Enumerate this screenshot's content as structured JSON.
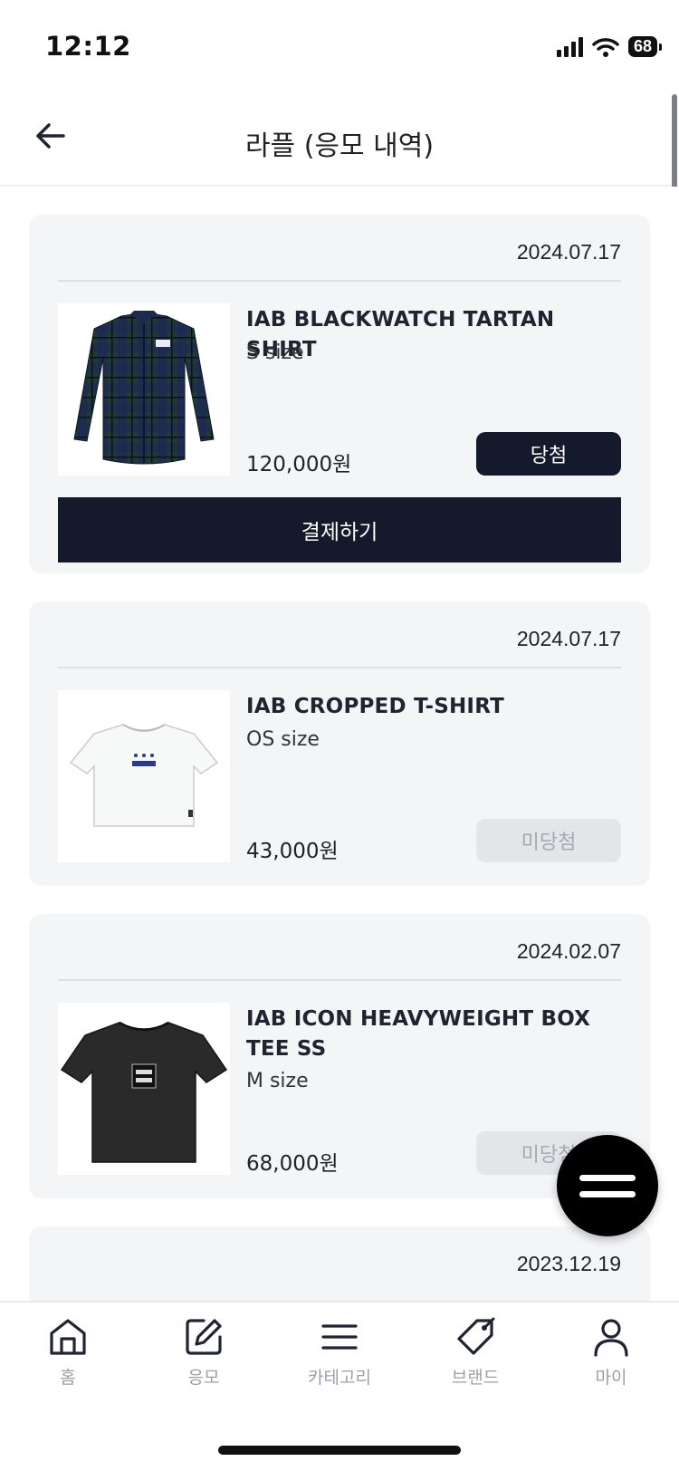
{
  "status_bar": {
    "time": "12:12",
    "battery": "68"
  },
  "header": {
    "title": "라플 (응모 내역)"
  },
  "entries": [
    {
      "date": "2024.07.17",
      "name": "IAB BLACKWATCH TARTAN SHIRT",
      "size": "S size",
      "price": "120,000원",
      "status": "당첨",
      "pay_label": "결제하기"
    },
    {
      "date": "2024.07.17",
      "name": "IAB CROPPED T-SHIRT",
      "size": "OS size",
      "price": "43,000원",
      "status": "미당첨"
    },
    {
      "date": "2024.02.07",
      "name": "IAB ICON HEAVYWEIGHT BOX TEE SS",
      "size": "M size",
      "price": "68,000원",
      "status": "미당첨"
    },
    {
      "date": "2023.12.19"
    }
  ],
  "tabbar": {
    "items": [
      {
        "label": "홈",
        "icon": "home-icon"
      },
      {
        "label": "응모",
        "icon": "edit-icon"
      },
      {
        "label": "카테고리",
        "icon": "menu-icon"
      },
      {
        "label": "브랜드",
        "icon": "tag-icon"
      },
      {
        "label": "마이",
        "icon": "user-icon"
      }
    ]
  },
  "colors": {
    "accent": "#141a2b",
    "card_bg": "#f4f5f7",
    "lose_bg": "#e3e5e9",
    "tab_label": "#9aa0a8"
  }
}
